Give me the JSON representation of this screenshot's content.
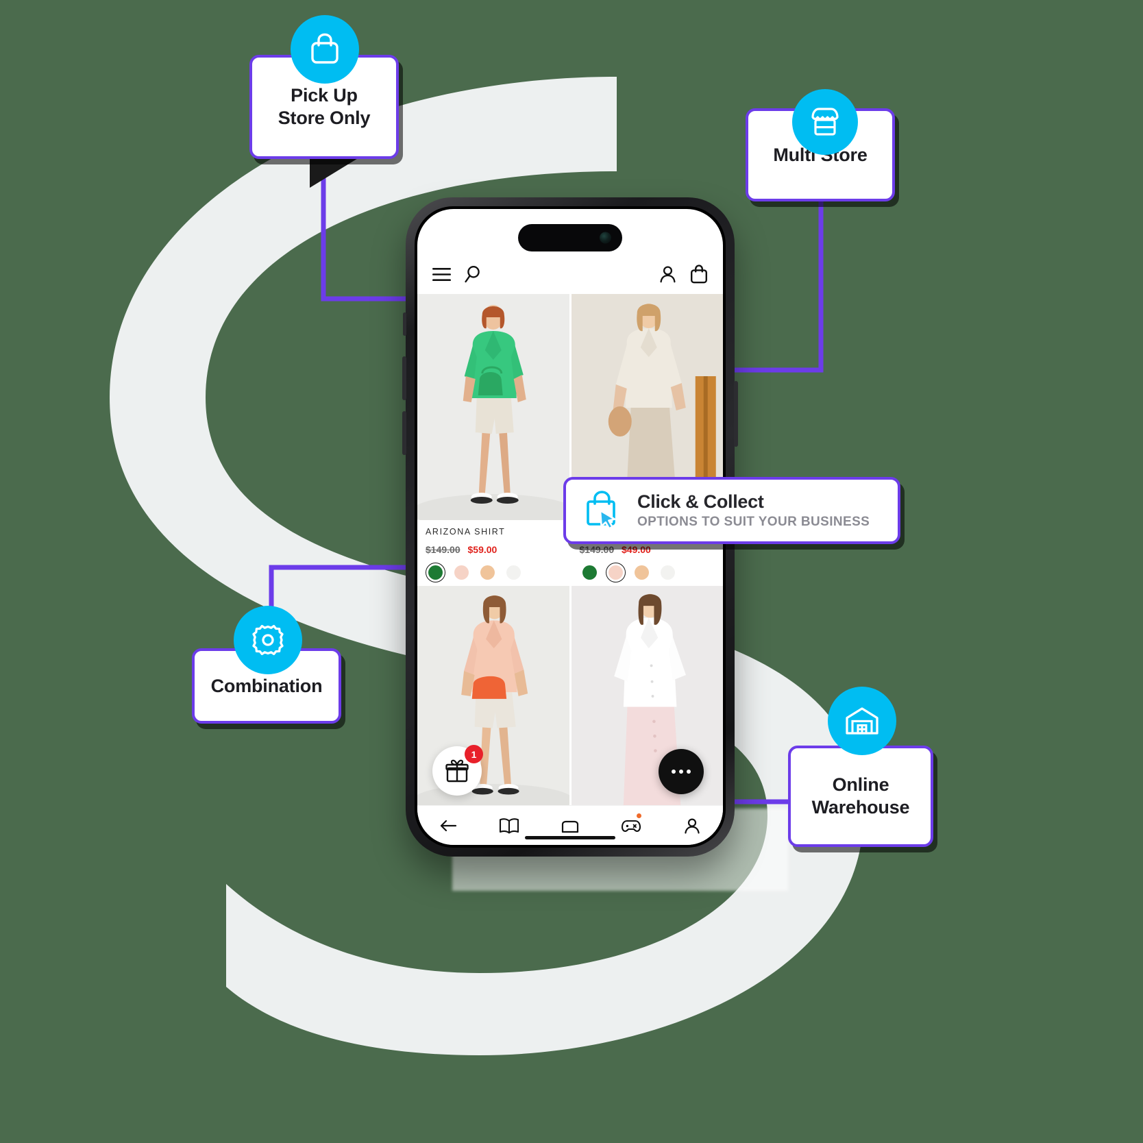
{
  "theme": {
    "background": "#4b6b4d",
    "swoosh": "#f4f6f7",
    "card_border": "#6c3ce9",
    "badge_fill": "#00bdf2",
    "card_fill": "#ffffff",
    "text_dark": "#1d1d22",
    "price_sale": "#e0221c",
    "price_old": "#6a6a6a",
    "badge_count_fill": "#e8202a"
  },
  "cards": [
    {
      "id": "pick-up-store-only",
      "label": "Pick Up\nStore Only",
      "line1": "Pick Up",
      "line2": "Store Only",
      "icon": "shopping-bag-icon"
    },
    {
      "id": "multi-store",
      "label": "Multi Store",
      "line1": "Multi Store",
      "line2": "",
      "icon": "storefront-icon"
    },
    {
      "id": "combination",
      "label": "Combination",
      "line1": "Combination",
      "line2": "",
      "icon": "gear-icon"
    },
    {
      "id": "online-warehouse",
      "label": "Online\nWarehouse",
      "line1": "Online",
      "line2": "Warehouse",
      "icon": "warehouse-icon"
    }
  ],
  "click_collect": {
    "title": "Click & Collect",
    "subtitle": "OPTIONS TO SUIT YOUR BUSINESS",
    "icon": "bag-cursor-icon"
  },
  "phone": {
    "header": {
      "menu_icon": "hamburger-menu-icon",
      "search_icon": "search-icon",
      "account_icon": "user-account-icon",
      "cart_icon": "shopping-bag-cart-icon"
    },
    "products": [
      {
        "name": "ARIZONA SHIRT",
        "price_old": "$149.00",
        "price_new": "$59.00",
        "swatches": [
          "#1d7a33",
          "#f6d3c6",
          "#f0c49a",
          "#f2f2f0"
        ],
        "selected_swatch": 0
      },
      {
        "name": "",
        "price_old": "$149.00",
        "price_new": "$49.00",
        "swatches": [
          "#1d7a33",
          "#f6d3c6",
          "#f0c49a",
          "#f2f2f0"
        ],
        "selected_swatch": 1
      }
    ],
    "gift_button": {
      "icon": "gift-icon",
      "badge": "1"
    },
    "chat_button": {
      "icon": "chat-dots-icon"
    },
    "nav": [
      {
        "id": "back",
        "icon": "arrow-left-icon"
      },
      {
        "id": "catalog",
        "icon": "book-open-icon"
      },
      {
        "id": "home",
        "icon": "home-icon"
      },
      {
        "id": "games",
        "icon": "game-controller-icon",
        "dot": true
      },
      {
        "id": "profile",
        "icon": "user-profile-icon"
      }
    ]
  }
}
